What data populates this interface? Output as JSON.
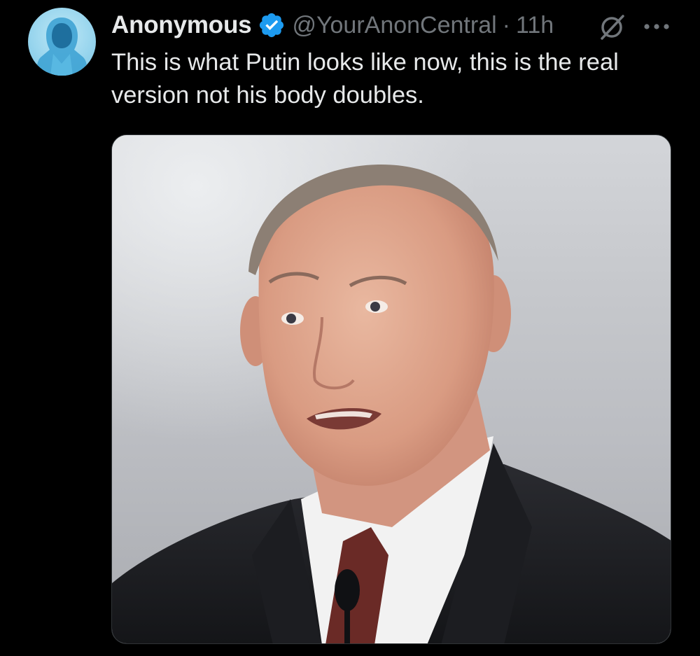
{
  "tweet": {
    "author": {
      "display_name": "Anonymous",
      "handle": "@YourAnonCentral",
      "verified": true,
      "avatar_icon": "hooded-figure-avatar"
    },
    "separator": "·",
    "timestamp": "11h",
    "actions": {
      "grok_icon": "grok-icon",
      "more_icon": "more-horizontal-icon"
    },
    "text": "This is what Putin looks like now, this is the real version not his body doubles.",
    "media": {
      "type": "photo",
      "icon": "photo-of-man-in-suit"
    }
  },
  "colors": {
    "background": "#000000",
    "primary_text": "#e7e9ea",
    "secondary_text": "#71767b",
    "verified_blue": "#1d9bf0",
    "avatar_bg": "#9ad6ee"
  }
}
